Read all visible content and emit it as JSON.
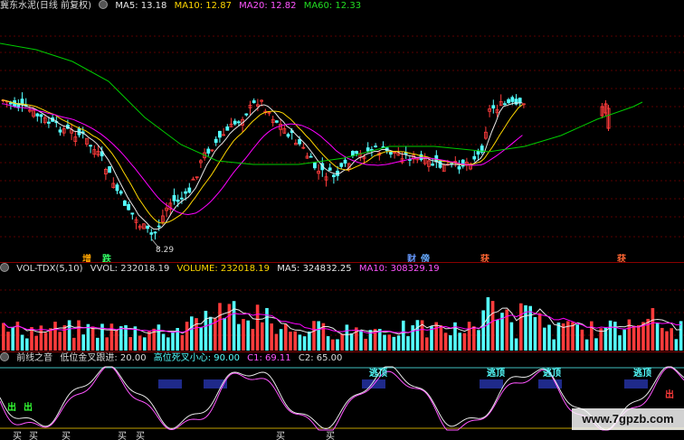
{
  "price_panel": {
    "stock_name": "冀东水泥(日线 前复权)",
    "ma5": "MA5: 13.18",
    "ma10": "MA10: 12.87",
    "ma20": "MA20: 12.82",
    "ma60": "MA60: 12.33",
    "low_label": "8.29",
    "markers": [
      "增",
      "跌",
      "财",
      "傍",
      "获",
      "获"
    ]
  },
  "vol_panel": {
    "name": "VOL-TDX(5,10)",
    "vvol": "VVOL: 232018.19",
    "volume": "VOLUME: 232018.19",
    "ma5": "MA5: 324832.25",
    "ma10": "MA10: 308329.19"
  },
  "indicator_panel": {
    "name": "前线之音",
    "low_cross": "低位金叉跟进: 20.00",
    "high_cross": "高位死叉小心: 90.00",
    "c1": "C1: 69.11",
    "c2": "C2: 65.00",
    "tags_top": [
      "逃顶",
      "逃顶",
      "逃顶",
      "逃顶"
    ],
    "buy_labels": [
      "买",
      "买",
      "买",
      "买",
      "买",
      "买",
      "买"
    ],
    "side_labels": [
      "出",
      "出",
      "出"
    ]
  },
  "watermark": "www.7gpzb.com",
  "colors": {
    "up": "#ff3b3b",
    "down": "#54ffff",
    "ma5": "#e8e8e8",
    "ma10": "#ffd700",
    "ma20": "#ff00ff",
    "ma60": "#00cc00",
    "vol_ma10": "#ff00ff"
  }
}
